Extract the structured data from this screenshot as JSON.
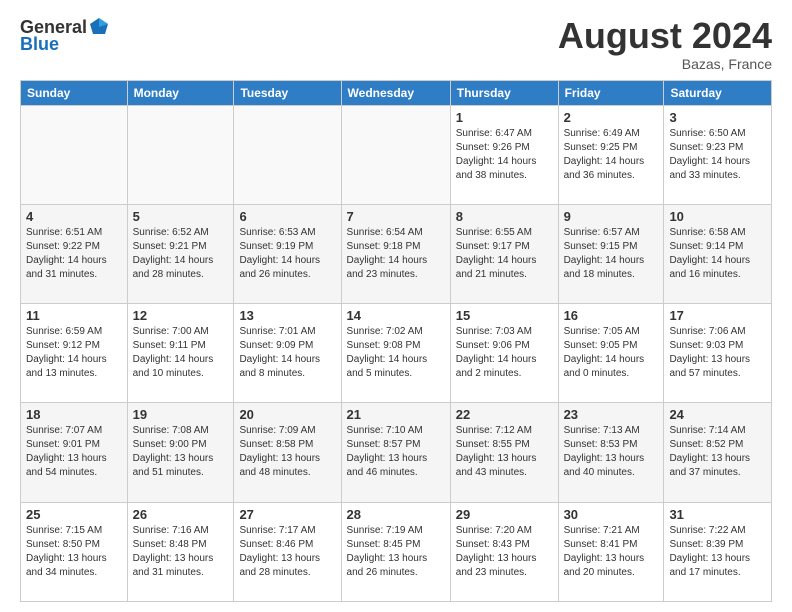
{
  "logo": {
    "general": "General",
    "blue": "Blue"
  },
  "title": "August 2024",
  "location": "Bazas, France",
  "days_header": [
    "Sunday",
    "Monday",
    "Tuesday",
    "Wednesday",
    "Thursday",
    "Friday",
    "Saturday"
  ],
  "weeks": [
    [
      {
        "day": "",
        "info": ""
      },
      {
        "day": "",
        "info": ""
      },
      {
        "day": "",
        "info": ""
      },
      {
        "day": "",
        "info": ""
      },
      {
        "day": "1",
        "info": "Sunrise: 6:47 AM\nSunset: 9:26 PM\nDaylight: 14 hours\nand 38 minutes."
      },
      {
        "day": "2",
        "info": "Sunrise: 6:49 AM\nSunset: 9:25 PM\nDaylight: 14 hours\nand 36 minutes."
      },
      {
        "day": "3",
        "info": "Sunrise: 6:50 AM\nSunset: 9:23 PM\nDaylight: 14 hours\nand 33 minutes."
      }
    ],
    [
      {
        "day": "4",
        "info": "Sunrise: 6:51 AM\nSunset: 9:22 PM\nDaylight: 14 hours\nand 31 minutes."
      },
      {
        "day": "5",
        "info": "Sunrise: 6:52 AM\nSunset: 9:21 PM\nDaylight: 14 hours\nand 28 minutes."
      },
      {
        "day": "6",
        "info": "Sunrise: 6:53 AM\nSunset: 9:19 PM\nDaylight: 14 hours\nand 26 minutes."
      },
      {
        "day": "7",
        "info": "Sunrise: 6:54 AM\nSunset: 9:18 PM\nDaylight: 14 hours\nand 23 minutes."
      },
      {
        "day": "8",
        "info": "Sunrise: 6:55 AM\nSunset: 9:17 PM\nDaylight: 14 hours\nand 21 minutes."
      },
      {
        "day": "9",
        "info": "Sunrise: 6:57 AM\nSunset: 9:15 PM\nDaylight: 14 hours\nand 18 minutes."
      },
      {
        "day": "10",
        "info": "Sunrise: 6:58 AM\nSunset: 9:14 PM\nDaylight: 14 hours\nand 16 minutes."
      }
    ],
    [
      {
        "day": "11",
        "info": "Sunrise: 6:59 AM\nSunset: 9:12 PM\nDaylight: 14 hours\nand 13 minutes."
      },
      {
        "day": "12",
        "info": "Sunrise: 7:00 AM\nSunset: 9:11 PM\nDaylight: 14 hours\nand 10 minutes."
      },
      {
        "day": "13",
        "info": "Sunrise: 7:01 AM\nSunset: 9:09 PM\nDaylight: 14 hours\nand 8 minutes."
      },
      {
        "day": "14",
        "info": "Sunrise: 7:02 AM\nSunset: 9:08 PM\nDaylight: 14 hours\nand 5 minutes."
      },
      {
        "day": "15",
        "info": "Sunrise: 7:03 AM\nSunset: 9:06 PM\nDaylight: 14 hours\nand 2 minutes."
      },
      {
        "day": "16",
        "info": "Sunrise: 7:05 AM\nSunset: 9:05 PM\nDaylight: 14 hours\nand 0 minutes."
      },
      {
        "day": "17",
        "info": "Sunrise: 7:06 AM\nSunset: 9:03 PM\nDaylight: 13 hours\nand 57 minutes."
      }
    ],
    [
      {
        "day": "18",
        "info": "Sunrise: 7:07 AM\nSunset: 9:01 PM\nDaylight: 13 hours\nand 54 minutes."
      },
      {
        "day": "19",
        "info": "Sunrise: 7:08 AM\nSunset: 9:00 PM\nDaylight: 13 hours\nand 51 minutes."
      },
      {
        "day": "20",
        "info": "Sunrise: 7:09 AM\nSunset: 8:58 PM\nDaylight: 13 hours\nand 48 minutes."
      },
      {
        "day": "21",
        "info": "Sunrise: 7:10 AM\nSunset: 8:57 PM\nDaylight: 13 hours\nand 46 minutes."
      },
      {
        "day": "22",
        "info": "Sunrise: 7:12 AM\nSunset: 8:55 PM\nDaylight: 13 hours\nand 43 minutes."
      },
      {
        "day": "23",
        "info": "Sunrise: 7:13 AM\nSunset: 8:53 PM\nDaylight: 13 hours\nand 40 minutes."
      },
      {
        "day": "24",
        "info": "Sunrise: 7:14 AM\nSunset: 8:52 PM\nDaylight: 13 hours\nand 37 minutes."
      }
    ],
    [
      {
        "day": "25",
        "info": "Sunrise: 7:15 AM\nSunset: 8:50 PM\nDaylight: 13 hours\nand 34 minutes."
      },
      {
        "day": "26",
        "info": "Sunrise: 7:16 AM\nSunset: 8:48 PM\nDaylight: 13 hours\nand 31 minutes."
      },
      {
        "day": "27",
        "info": "Sunrise: 7:17 AM\nSunset: 8:46 PM\nDaylight: 13 hours\nand 28 minutes."
      },
      {
        "day": "28",
        "info": "Sunrise: 7:19 AM\nSunset: 8:45 PM\nDaylight: 13 hours\nand 26 minutes."
      },
      {
        "day": "29",
        "info": "Sunrise: 7:20 AM\nSunset: 8:43 PM\nDaylight: 13 hours\nand 23 minutes."
      },
      {
        "day": "30",
        "info": "Sunrise: 7:21 AM\nSunset: 8:41 PM\nDaylight: 13 hours\nand 20 minutes."
      },
      {
        "day": "31",
        "info": "Sunrise: 7:22 AM\nSunset: 8:39 PM\nDaylight: 13 hours\nand 17 minutes."
      }
    ]
  ]
}
